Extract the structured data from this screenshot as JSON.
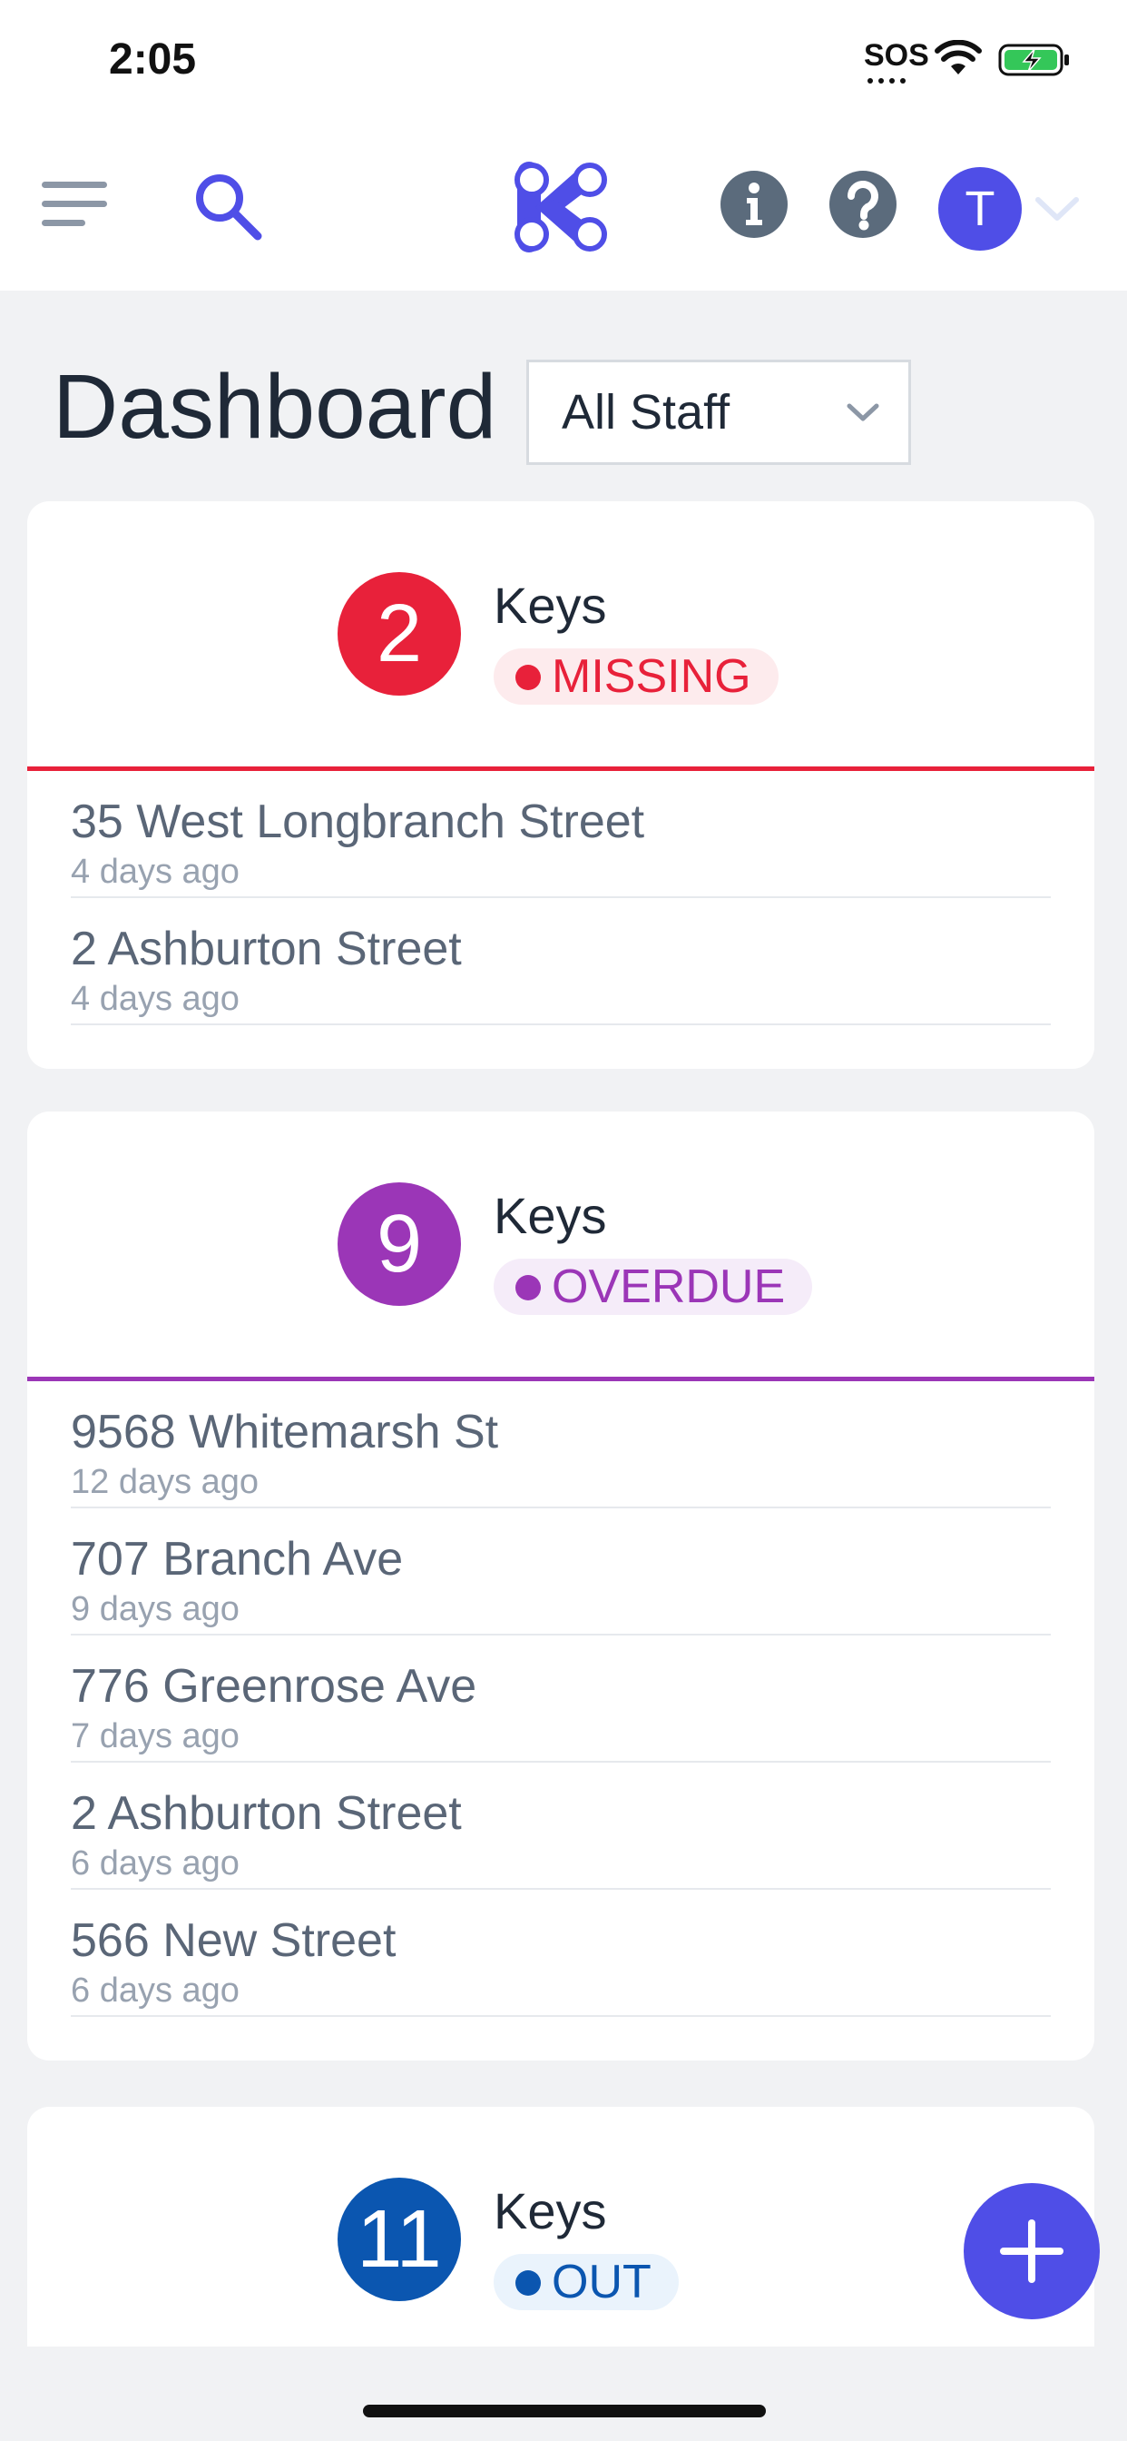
{
  "status_bar": {
    "time": "2:05",
    "sos": "SOS"
  },
  "header": {
    "avatar_initial": "T"
  },
  "page": {
    "title": "Dashboard",
    "staff_filter": {
      "selected": "All Staff"
    }
  },
  "cards": [
    {
      "count": "2",
      "keys_label": "Keys",
      "status": "MISSING",
      "color": "#e8213a",
      "pill_bg": "#fdebed",
      "items": [
        {
          "address": "35 West Longbranch Street",
          "time": "4 days ago"
        },
        {
          "address": "2 Ashburton Street",
          "time": "4 days ago"
        }
      ]
    },
    {
      "count": "9",
      "keys_label": "Keys",
      "status": "OVERDUE",
      "color": "#9b36b7",
      "pill_bg": "#f5ecf9",
      "items": [
        {
          "address": "9568 Whitemarsh St",
          "time": "12 days ago"
        },
        {
          "address": "707 Branch Ave",
          "time": "9 days ago"
        },
        {
          "address": "776 Greenrose Ave",
          "time": "7 days ago"
        },
        {
          "address": "2 Ashburton Street",
          "time": "6 days ago"
        },
        {
          "address": "566 New Street",
          "time": "6 days ago"
        }
      ]
    },
    {
      "count": "11",
      "keys_label": "Keys",
      "status": "OUT",
      "color": "#0b56b0",
      "pill_bg": "#eaf3fc",
      "items": []
    }
  ],
  "colors": {
    "accent": "#4f4ee7",
    "icon_gray": "#5b6b7c"
  },
  "icons": {
    "menu": "hamburger-menu-icon",
    "search": "search-icon",
    "logo": "app-logo",
    "info": "info-icon",
    "help": "help-icon",
    "chevron": "chevron-down-icon",
    "fab": "plus-icon"
  }
}
